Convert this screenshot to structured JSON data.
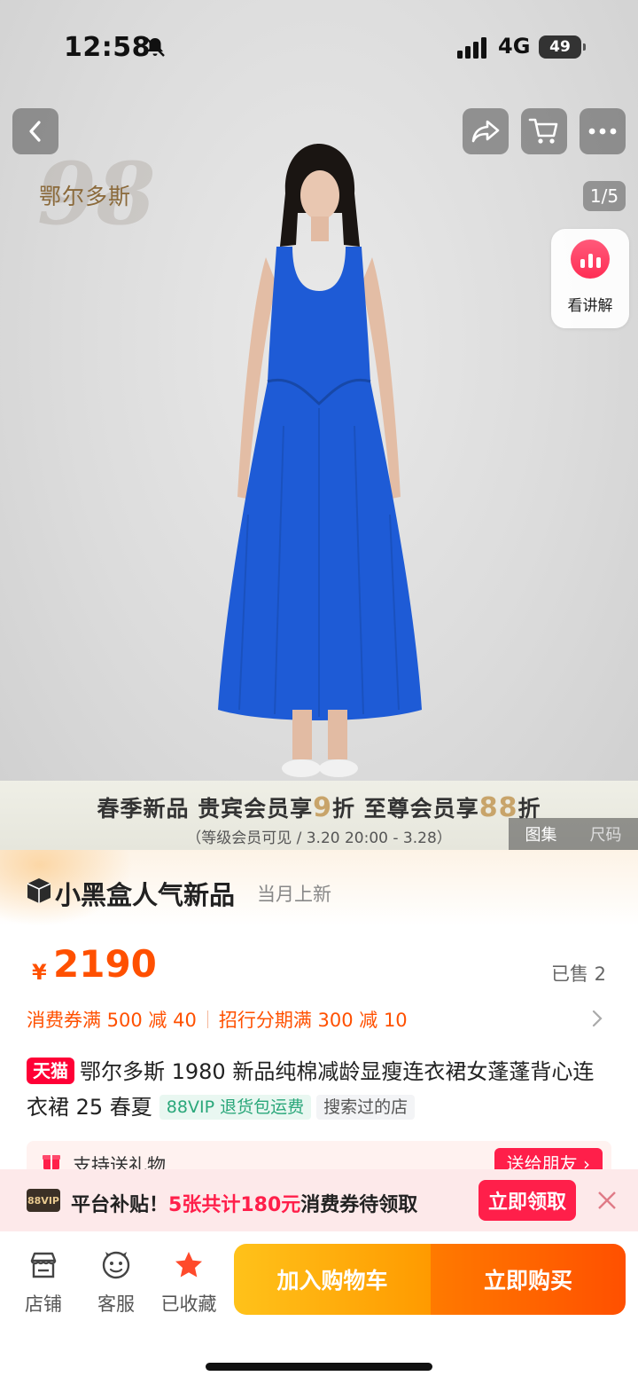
{
  "status_bar": {
    "time": "12:58",
    "network": "4G",
    "battery": "49"
  },
  "hero": {
    "brand_watermark": "鄂尔多斯",
    "brand_watermark_number": "98",
    "page_counter": "1/5",
    "explain_label": "看讲解",
    "promo_pre1": "春季新品 贵宾会员享",
    "promo_num1": "9",
    "promo_mid": "折 至尊会员享",
    "promo_num2": "88",
    "promo_post": "折",
    "promo_sub": "（等级会员可见 / 3.20 20:00 - 3.28）",
    "gallery_tabs": [
      "图集",
      "尺码"
    ]
  },
  "arrival": {
    "title": "小黑盒人气新品",
    "subtitle": "当月上新"
  },
  "price": {
    "symbol": "¥",
    "value": "2190",
    "sold": "已售 2"
  },
  "coupons": {
    "coupon1": "消费券满 500 减 40",
    "coupon2": "招行分期满 300 减 10"
  },
  "product": {
    "platform_badge": "天猫",
    "title": "鄂尔多斯 1980 新品纯棉减龄显瘦连衣裙女蓬蓬背心连衣裙 25 春夏",
    "tag_vip": "88VIP 退货包运费",
    "tag_searched": "搜索过的店"
  },
  "gift": {
    "label": "支持送礼物",
    "button": "送给朋友 ›"
  },
  "subsidy": {
    "badge": "88VIP",
    "prefix": "平台补贴！",
    "highlight": "5张共计180元",
    "suffix": "消费券待领取",
    "claim": "立即领取"
  },
  "bottom_bar": {
    "store": "店铺",
    "service": "客服",
    "favorite": "已收藏",
    "add_cart": "加入购物车",
    "buy_now": "立即购买"
  },
  "colors": {
    "accent": "#ff5000",
    "tmall_red": "#ff0036",
    "dress_blue": "#1e5bd6",
    "favorite_star": "#ff4a2b"
  }
}
